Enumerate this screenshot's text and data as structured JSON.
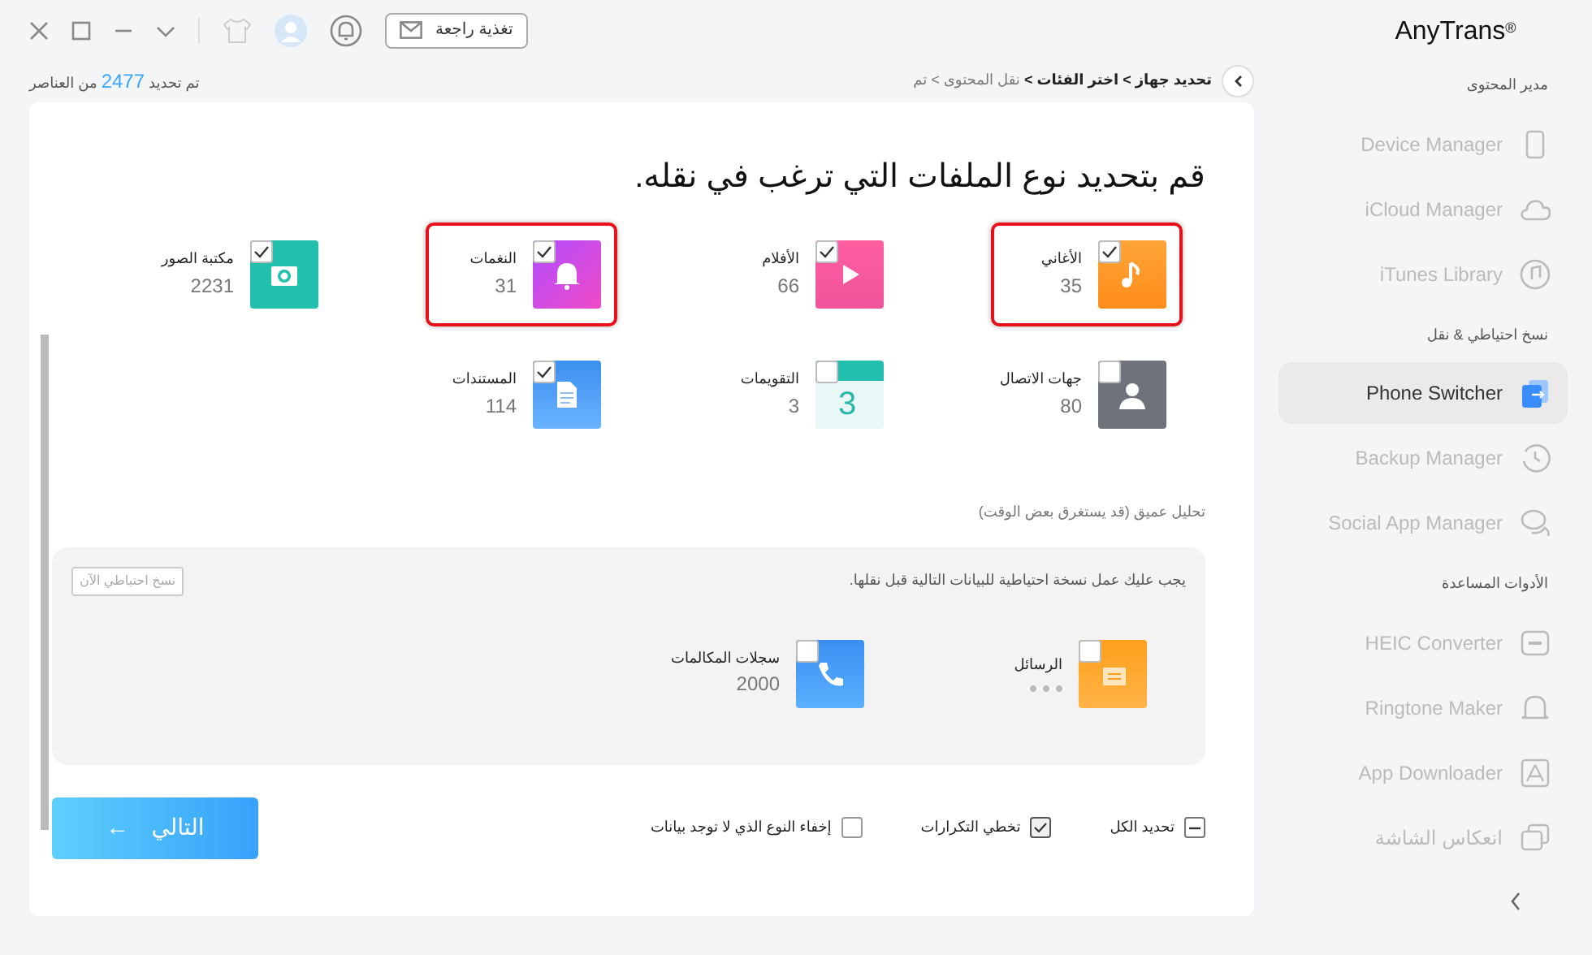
{
  "top_bar": {
    "feedback_button": "تغذية راجعة"
  },
  "status": {
    "prefix": "تم تحديد",
    "count": "2477",
    "suffix": "من العناصر"
  },
  "breadcrumb": {
    "separator": ">",
    "steps": [
      {
        "label": "تحديد جهاز",
        "done": true
      },
      {
        "label": "اختر الفئات",
        "done": true
      },
      {
        "label": "نقل المحتوى",
        "done": false
      },
      {
        "label": "تم",
        "done": false
      }
    ]
  },
  "heading": "قم بتحديد نوع الملفات التي ترغب في نقله.",
  "categories": [
    {
      "kind": "music",
      "label": "الأغاني",
      "count": "35",
      "checked": true,
      "highlighted": true
    },
    {
      "kind": "movies",
      "label": "الأفلام",
      "count": "66",
      "checked": true,
      "highlighted": false
    },
    {
      "kind": "ringtones",
      "label": "النغمات",
      "count": "31",
      "checked": true,
      "highlighted": true
    },
    {
      "kind": "photos",
      "label": "مكتبة الصور",
      "count": "2231",
      "checked": true,
      "highlighted": false
    },
    {
      "kind": "contacts",
      "label": "جهات الاتصال",
      "count": "80",
      "checked": false,
      "highlighted": false
    },
    {
      "kind": "calendar",
      "label": "التقويمات",
      "count": "3",
      "glyph": "3",
      "checked": false,
      "highlighted": false
    },
    {
      "kind": "documents",
      "label": "المستندات",
      "count": "114",
      "checked": true,
      "highlighted": false
    }
  ],
  "deep_scan": "تحليل عميق (قد يستغرق بعض الوقت)",
  "backup_panel": {
    "note": "يجب عليك عمل نسخة احتياطية للبيانات التالية قبل نقلها.",
    "button": "نسخ احتياطي الآن",
    "items": [
      {
        "kind": "messages",
        "label": "الرسائل",
        "loading": true,
        "checked": false
      },
      {
        "kind": "calls",
        "label": "سجلات المكالمات",
        "count": "2000",
        "loading": false,
        "checked": false
      }
    ]
  },
  "options": [
    {
      "label": "تحديد الكل",
      "checked": false,
      "mixed": true
    },
    {
      "label": "تخطي التكرارات",
      "checked": true,
      "mixed": false
    },
    {
      "label": "إخفاء النوع الذي لا توجد بيانات",
      "checked": false,
      "mixed": false
    }
  ],
  "next_button": {
    "label": "التالي",
    "arrow": "←"
  },
  "sidebar": {
    "brand": "AnyTrans$^{®}$",
    "sections": [
      {
        "title": "مدير المحتوى",
        "items": [
          {
            "kind": "device",
            "label": "Device Manager",
            "selected": false
          },
          {
            "kind": "cloud",
            "label": "iCloud Manager",
            "selected": false
          },
          {
            "kind": "itunes",
            "label": "iTunes Library",
            "selected": false
          }
        ]
      },
      {
        "title": "نسخ احتياطي & نقل",
        "items": [
          {
            "kind": "switcher",
            "label": "Phone Switcher",
            "selected": true
          },
          {
            "kind": "backup",
            "label": "Backup Manager",
            "selected": false
          },
          {
            "kind": "social",
            "label": "Social App Manager",
            "selected": false
          }
        ]
      },
      {
        "title": "الأدوات المساعدة",
        "items": [
          {
            "kind": "heic",
            "label": "HEIC Converter",
            "selected": false
          },
          {
            "kind": "ringtone",
            "label": "Ringtone Maker",
            "selected": false
          },
          {
            "kind": "appstore",
            "label": "App Downloader",
            "selected": false
          },
          {
            "kind": "mirror",
            "label": "انعكاس الشاشة",
            "selected": false
          }
        ]
      }
    ]
  }
}
